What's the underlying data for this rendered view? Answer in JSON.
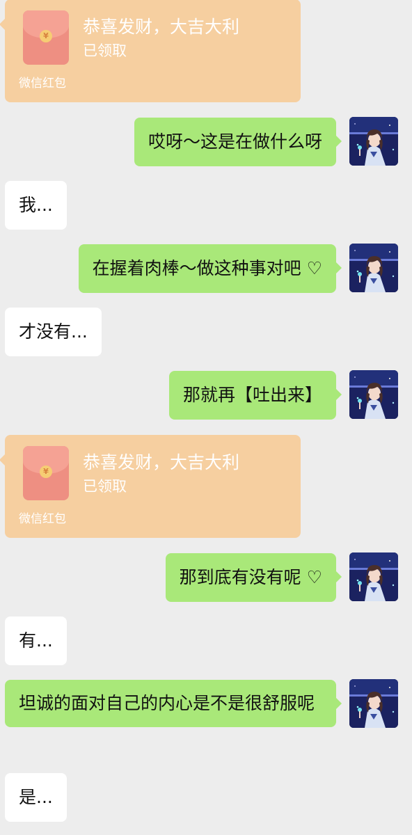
{
  "messages": {
    "packet_1": {
      "title": "恭喜发财，大吉大利",
      "status": "已领取",
      "footer": "微信红包"
    },
    "msg_1": "哎呀～这是在做什么呀",
    "msg_2": "我...",
    "msg_3": "在握着肉棒～做这种事对吧 ♡",
    "msg_4": "才没有...",
    "msg_5": "那就再【吐出来】",
    "packet_2": {
      "title": "恭喜发财，大吉大利",
      "status": "已领取",
      "footer": "微信红包"
    },
    "msg_6": "那到底有没有呢 ♡",
    "msg_7": "有...",
    "msg_8": "坦诚的面对自己的内心是不是很舒服呢",
    "msg_9": "是..."
  },
  "packet_coin_symbol": "¥",
  "colors": {
    "background": "#ededed",
    "my_bubble": "#a9e879",
    "other_bubble": "#ffffff",
    "red_packet": "#f6cfa0"
  },
  "icons": {
    "avatar": "anime-girl-avatar",
    "packet": "red-envelope-icon"
  }
}
